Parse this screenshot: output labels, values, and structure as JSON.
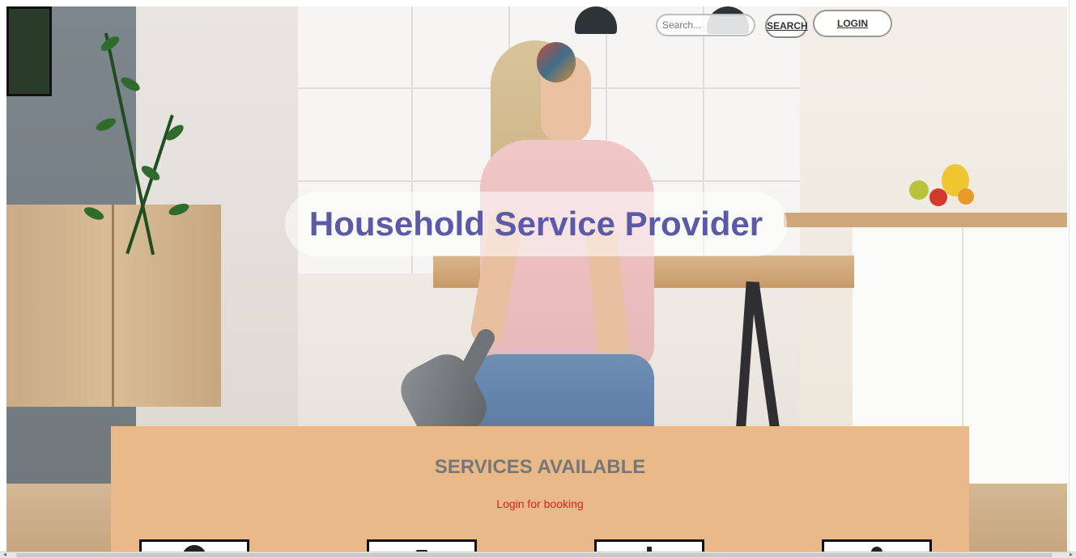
{
  "header": {
    "search_placeholder": "Search...",
    "search_label": "SEARCH",
    "login_label": "LOGIN"
  },
  "hero": {
    "title": "Household Service Provider"
  },
  "services": {
    "heading": "SERVICES AVAILABLE",
    "note": "Login for booking"
  },
  "scrollbar": {
    "left_arrow": "◂",
    "right_arrow": "▸"
  },
  "colors": {
    "title": "#5b5aa8",
    "panel": "#e9b98a",
    "heading": "#777777",
    "note": "#e02020"
  }
}
